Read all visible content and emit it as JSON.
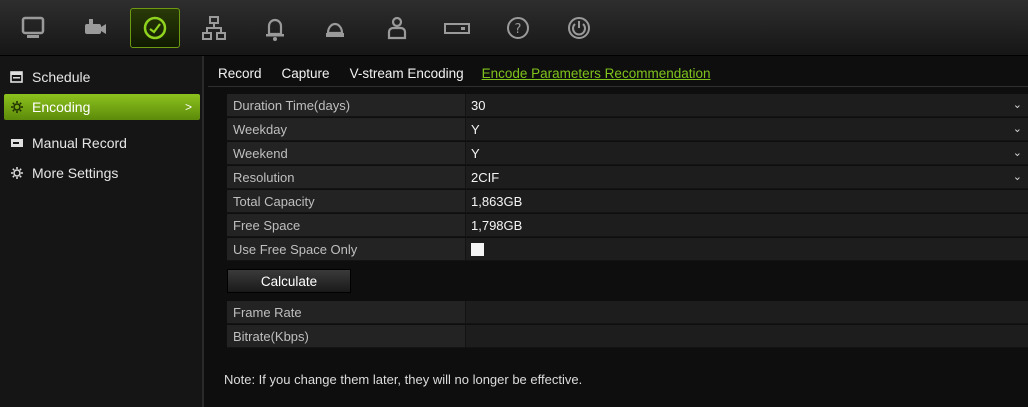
{
  "toolbar": {
    "icons": [
      "monitor-icon",
      "camera-icon",
      "record-clock-icon",
      "network-icon",
      "alarm-bell-icon",
      "device-icon",
      "user-icon",
      "hdd-icon",
      "help-icon",
      "power-icon"
    ],
    "active_index": 2,
    "accent": "#7fc31c"
  },
  "sidebar": {
    "items": [
      {
        "label": "Schedule",
        "icon": "schedule-icon"
      },
      {
        "label": "Encoding",
        "icon": "encoding-icon",
        "active": true,
        "chevron": ">"
      },
      {
        "label": "Manual Record",
        "icon": "manual-record-icon"
      },
      {
        "label": "More Settings",
        "icon": "settings-icon"
      }
    ]
  },
  "tabs": [
    {
      "label": "Record"
    },
    {
      "label": "Capture"
    },
    {
      "label": "V-stream Encoding"
    },
    {
      "label": "Encode Parameters Recommendation",
      "active": true
    }
  ],
  "form": {
    "rows": [
      {
        "label": "Duration Time(days)",
        "value": "30",
        "dropdown": true
      },
      {
        "label": "Weekday",
        "value": "Y",
        "dropdown": true
      },
      {
        "label": "Weekend",
        "value": "Y",
        "dropdown": true
      },
      {
        "label": "Resolution",
        "value": "2CIF",
        "dropdown": true
      },
      {
        "label": "Total Capacity",
        "value": "1,863GB"
      },
      {
        "label": "Free Space",
        "value": "1,798GB"
      },
      {
        "label": "Use Free Space Only",
        "checkbox": true,
        "checked": false
      }
    ],
    "calculate_label": "Calculate",
    "results": [
      {
        "label": "Frame Rate",
        "value": ""
      },
      {
        "label": "Bitrate(Kbps)",
        "value": ""
      }
    ],
    "dropdown_glyph": "⌄"
  },
  "note": "Note: If you change them later, they will no longer be effective."
}
